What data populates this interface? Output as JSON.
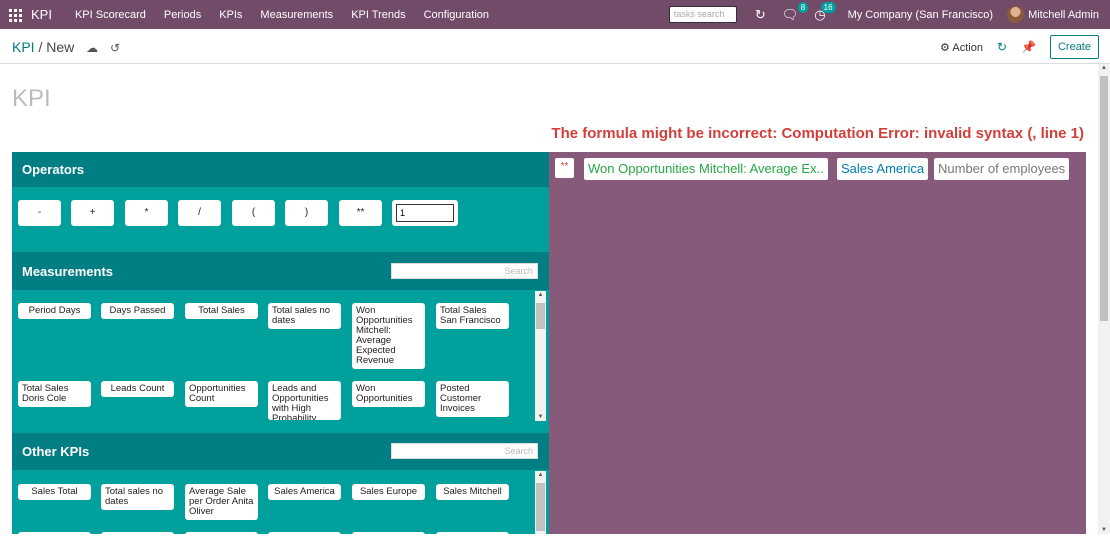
{
  "nav": {
    "brand": "KPI",
    "menu": [
      "KPI Scorecard",
      "Periods",
      "KPIs",
      "Measurements",
      "KPI Trends",
      "Configuration"
    ],
    "search_placeholder": "tasks search",
    "messages_count": "8",
    "activities_count": "16",
    "company": "My Company (San Francisco)",
    "user": "Mitchell Admin"
  },
  "breadcrumb": {
    "parent": "KPI",
    "current": "New"
  },
  "toolbar": {
    "action_label": "Action",
    "create_label": "Create"
  },
  "form": {
    "title_placeholder": "KPI",
    "error_message": "The formula might be incorrect: Computation Error: invalid syntax (, line 1)"
  },
  "operators": {
    "title": "Operators",
    "buttons": [
      "-",
      "+",
      "*",
      "/",
      "(",
      ")",
      "**"
    ],
    "number_value": "1"
  },
  "measurements": {
    "title": "Measurements",
    "search_placeholder": "Search",
    "items": [
      "Period Days",
      "Days Passed",
      "Total Sales",
      "Total sales no dates",
      "Won Opportunities Mitchell: Average Expected Revenue",
      "Total Sales San Francisco",
      "Total Sales Doris Cole",
      "Leads Count",
      "Opportunities Count",
      "Leads and Opportunities with High Probability",
      "Won Opportunities",
      "Posted Customer Invoices"
    ]
  },
  "other_kpis": {
    "title": "Other KPIs",
    "search_placeholder": "Search",
    "items": [
      "Sales Total",
      "Total sales no dates",
      "Average Sale per Order Anita Oliver",
      "Sales America",
      "Sales Europe",
      "Sales Mitchell"
    ]
  },
  "formula": {
    "tokens": [
      "**",
      "Won Opportunities Mitchell: Average Ex..",
      "Sales America",
      "Number of employees"
    ]
  },
  "colors": {
    "brand_purple": "#714b67",
    "panel_teal": "#00a09d",
    "header_teal": "#017e84",
    "canvas_purple": "#875a7b",
    "error_red": "#d23f3a",
    "measurement_green": "#28a745",
    "kpi_blue": "#007bb5"
  }
}
